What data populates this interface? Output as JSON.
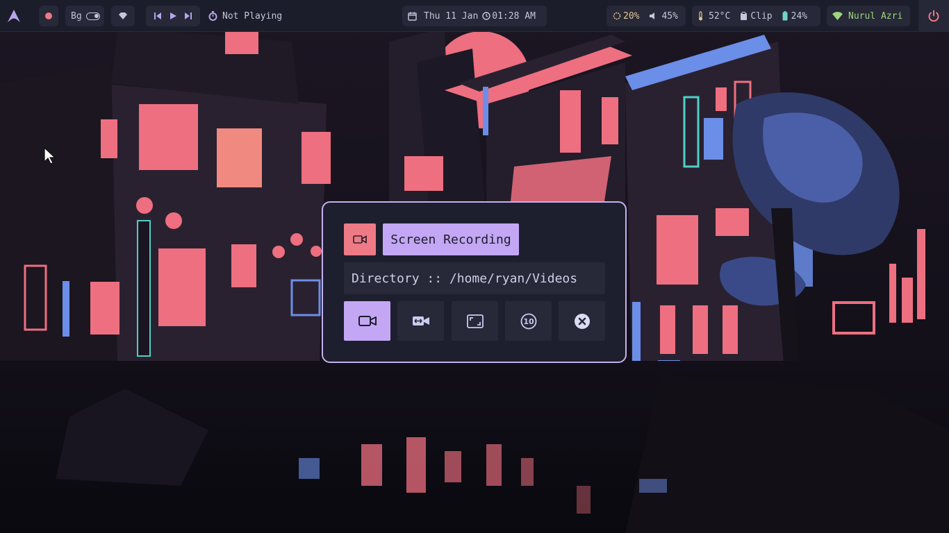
{
  "topbar": {
    "workspace_label": "Bg",
    "media_status": "Not Playing",
    "date": "Thu 11 Jan",
    "time": "01:28 AM",
    "brightness": "20%",
    "volume": "45%",
    "temperature": "52°C",
    "clipboard_label": "Clip",
    "battery": "24%",
    "wifi_name": "Nurul Azri"
  },
  "dialog": {
    "title": "Screen Recording",
    "directory_text": "Directory :: /home/ryan/Videos",
    "buttons": [
      "record-fullscreen",
      "record-area",
      "record-window",
      "record-delayed-10",
      "cancel"
    ],
    "active_button": "record-fullscreen"
  },
  "colors": {
    "accent_purple": "#c3a7f4",
    "accent_pink": "#ee7a86",
    "bar_bg": "#1c1d2b",
    "module_bg": "#272838",
    "wifi_green": "#9ed67a"
  }
}
